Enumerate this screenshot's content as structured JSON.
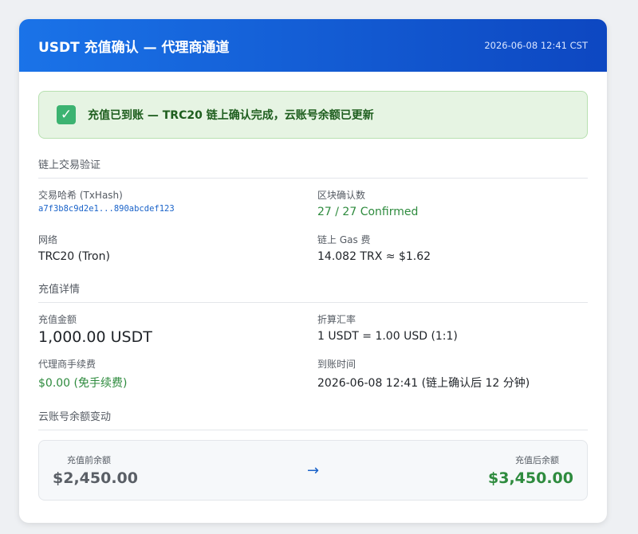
{
  "header": {
    "title": "USDT 充值确认 — 代理商通道",
    "timestamp": "2026-06-08 12:41 CST"
  },
  "alert": {
    "icon": "check-icon",
    "message": "充值已到账 — TRC20 链上确认完成，云账号余额已更新"
  },
  "chain_section": {
    "title": "链上交易验证",
    "txhash_label": "交易哈希 (TxHash)",
    "txhash_value": "a7f3b8c9d2e1...890abcdef123",
    "confirmations_label": "区块确认数",
    "confirmations_value": "27 / 27 Confirmed",
    "network_label": "网络",
    "network_value": "TRC20 (Tron)",
    "gas_label": "链上 Gas 费",
    "gas_value": "14.082 TRX ≈ $1.62"
  },
  "recharge_section": {
    "title": "充值详情",
    "amount_label": "充值金额",
    "amount_value": "1,000.00 USDT",
    "rate_label": "折算汇率",
    "rate_value": "1 USDT = 1.00 USD (1:1)",
    "fee_label": "代理商手续费",
    "fee_value": "$0.00 (免手续费)",
    "arrival_label": "到账时间",
    "arrival_value": "2026-06-08 12:41 (链上确认后 12 分钟)"
  },
  "balance_section": {
    "title": "云账号余额变动",
    "before_label": "充值前余额",
    "before_value": "$2,450.00",
    "arrow": "→",
    "after_label": "充值后余额",
    "after_value": "$3,450.00"
  },
  "colors": {
    "header_start": "#1a73e8",
    "header_end": "#0d47c1",
    "success_green": "#2e8b3e",
    "link_blue": "#1a63c9"
  }
}
